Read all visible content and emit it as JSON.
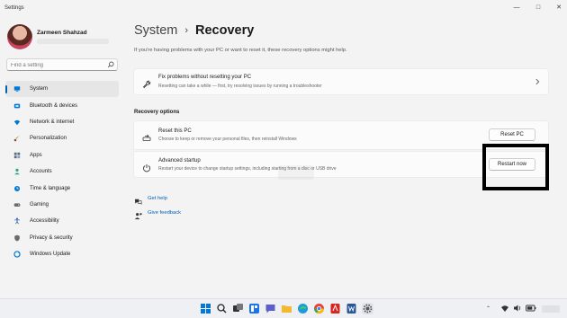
{
  "window": {
    "app_title": "Settings",
    "controls": [
      "—",
      "□",
      "✕"
    ]
  },
  "profile": {
    "name": "Zarmeen Shahzad"
  },
  "search": {
    "placeholder": "Find a setting"
  },
  "sidebar": {
    "items": [
      {
        "label": "System",
        "icon": "monitor-icon",
        "selected": true,
        "color": "#0078d4"
      },
      {
        "label": "Bluetooth & devices",
        "icon": "bluetooth-icon",
        "color": "#0078d4"
      },
      {
        "label": "Network & internet",
        "icon": "wifi-icon",
        "color": "#0078d4"
      },
      {
        "label": "Personalization",
        "icon": "brush-icon",
        "color": "#c7833b"
      },
      {
        "label": "Apps",
        "icon": "apps-icon",
        "color": "#5a6c80"
      },
      {
        "label": "Accounts",
        "icon": "person-icon",
        "color": "#2aa876"
      },
      {
        "label": "Time & language",
        "icon": "globe-clock-icon",
        "color": "#0078d4"
      },
      {
        "label": "Gaming",
        "icon": "gamepad-icon",
        "color": "#6b6b6b"
      },
      {
        "label": "Accessibility",
        "icon": "accessibility-icon",
        "color": "#1f5fa8"
      },
      {
        "label": "Privacy & security",
        "icon": "shield-icon",
        "color": "#6b6b6b"
      },
      {
        "label": "Windows Update",
        "icon": "update-icon",
        "color": "#0078d4"
      }
    ]
  },
  "header": {
    "parent": "System",
    "separator": "›",
    "current": "Recovery"
  },
  "intro": "If you're having problems with your PC or want to reset it, these recovery options might help.",
  "fix_card": {
    "title": "Fix problems without resetting your PC",
    "subtitle": "Resetting can take a while — first, try resolving issues by running a troubleshooter"
  },
  "recovery_options": {
    "heading": "Recovery options",
    "reset": {
      "title": "Reset this PC",
      "subtitle": "Choose to keep or remove your personal files, then reinstall Windows",
      "button": "Reset PC"
    },
    "advanced": {
      "title": "Advanced startup",
      "subtitle": "Restart your device to change startup settings, including starting from a disc or USB drive",
      "button": "Restart now"
    }
  },
  "links": {
    "help": "Get help",
    "feedback": "Give feedback"
  },
  "colors": {
    "accent": "#005fb8",
    "background": "#f3f3f3",
    "card": "#fbfbfb",
    "highlight": "#000000"
  }
}
